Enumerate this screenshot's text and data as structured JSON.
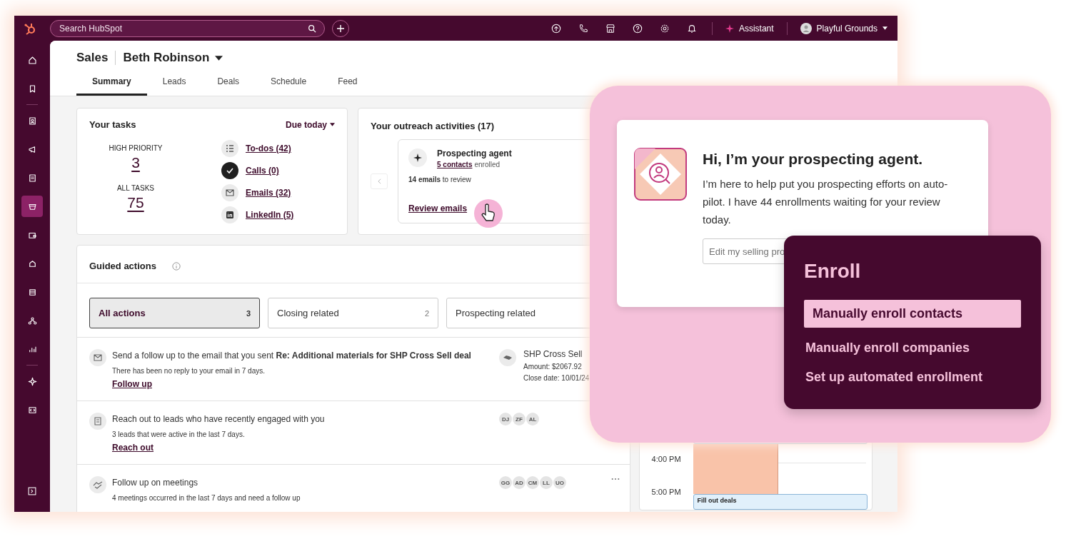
{
  "topbar": {
    "search": {
      "placeholder": "Search HubSpot"
    },
    "assistant": "Assistant",
    "account": "Playful Grounds"
  },
  "sidebar": {
    "items": [
      {
        "selected": false
      },
      {
        "selected": false
      },
      {
        "selected": false
      },
      {
        "selected": false
      },
      {
        "selected": false
      },
      {
        "selected": true
      },
      {
        "selected": false
      },
      {
        "selected": false
      },
      {
        "selected": false
      },
      {
        "selected": false
      },
      {
        "selected": false
      },
      {
        "selected": false
      },
      {
        "selected": false
      }
    ]
  },
  "header": {
    "section": "Sales",
    "owner": "Beth Robinson",
    "tabs": [
      {
        "label": "Summary",
        "selected": true
      },
      {
        "label": "Leads",
        "selected": false
      },
      {
        "label": "Deals",
        "selected": false
      },
      {
        "label": "Schedule",
        "selected": false
      },
      {
        "label": "Feed",
        "selected": false
      }
    ]
  },
  "tasks": {
    "title": "Your tasks",
    "filter": "Due today",
    "stats": [
      {
        "label": "HIGH PRIORITY",
        "value": "3"
      },
      {
        "label": "ALL TASKS",
        "value": "75"
      }
    ],
    "links": [
      {
        "kind": "todos",
        "label": "To-dos (42)"
      },
      {
        "kind": "calls",
        "label": "Calls (0)"
      },
      {
        "kind": "emails",
        "label": "Emails (32)"
      },
      {
        "kind": "linkedin",
        "label": "LinkedIn (5)"
      }
    ]
  },
  "outreach": {
    "title": "Your outreach activities (17)",
    "agent": {
      "name": "Prospecting agent",
      "contacts_link": "5 contacts",
      "enrolled": "enrolled",
      "review": "**14 emails** to review",
      "action": "Review emails"
    }
  },
  "guided": {
    "title": "Guided actions",
    "filters": [
      {
        "label": "All actions",
        "count": "3",
        "selected": true
      },
      {
        "label": "Closing related",
        "count": "2",
        "selected": false
      },
      {
        "label": "Prospecting related",
        "selected": false
      }
    ],
    "actions": [
      {
        "kind": "email",
        "text": "Send a follow up to the email that you sent **Re: Additional materials for SHP Cross Sell deal**",
        "detail": "There has been no reply to your email in 7 days.",
        "link": "Follow up",
        "deal": {
          "name": "SHP Cross Sell",
          "amount": "Amount: $2067.92",
          "close": "Close date: 10/01/24"
        }
      },
      {
        "kind": "leads",
        "text": "Reach out to leads who have recently engaged with you",
        "detail": "3 leads that were active in the last 7 days.",
        "link": "Reach out",
        "avatars": [
          "DJ",
          "ZF",
          "AL"
        ]
      },
      {
        "kind": "meetings",
        "text": "Follow up on meetings",
        "detail": "4 meetings occurred in the last 7 days and need a follow up",
        "avatars": [
          "GG",
          "AD",
          "CM",
          "LL",
          "UO"
        ],
        "more": true
      }
    ]
  },
  "calendar": {
    "times": [
      "4:00 PM",
      "5:00 PM"
    ],
    "event": "Fill out deals"
  },
  "agent_card": {
    "title": "Hi, I’m your prospecting agent.",
    "body": "I’m here to help put you prospecting efforts on auto-pilot. I have 44 enrollments waiting for your review today.",
    "input": {
      "placeholder": "Edit my selling pro"
    }
  },
  "enroll_menu": {
    "title": "Enroll",
    "items": [
      {
        "label": "Manually enroll contacts",
        "selected": true
      },
      {
        "label": "Manually enroll companies",
        "selected": false
      },
      {
        "label": "Set up automated enrollment",
        "selected": false
      }
    ]
  }
}
